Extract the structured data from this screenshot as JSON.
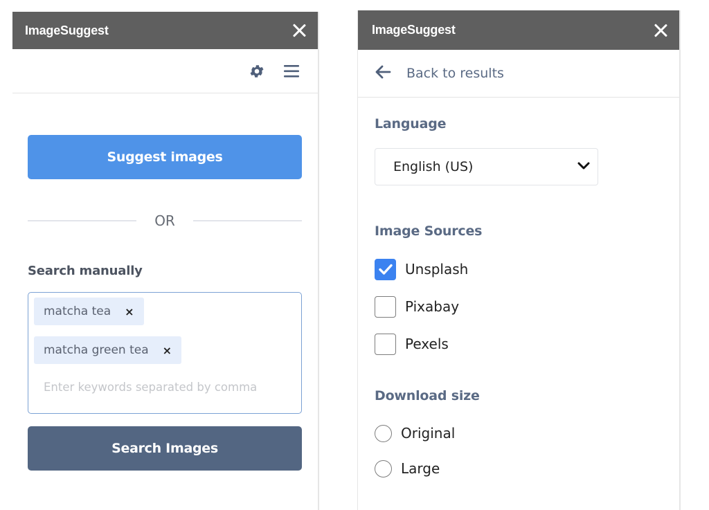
{
  "colors": {
    "titlebar_bg": "#5f5f5f",
    "suggest_button_bg": "#4f93e8",
    "search_button_bg": "#536682",
    "checkbox_checked": "#3b82f0",
    "label_slate": "#5a6a84"
  },
  "left_panel": {
    "title": "ImageSuggest",
    "close_icon": "close-icon",
    "toolbar": {
      "settings_icon": "gear-icon",
      "menu_icon": "hamburger-menu-icon"
    },
    "suggest_button_label": "Suggest images",
    "divider_text": "OR",
    "search_manually_label": "Search manually",
    "keywords": [
      {
        "label": "matcha tea",
        "remove_symbol": "×"
      },
      {
        "label": "matcha green tea",
        "remove_symbol": "×"
      }
    ],
    "keyword_input": {
      "value": "",
      "placeholder": "Enter keywords separated by comma"
    },
    "search_button_label": "Search Images"
  },
  "right_panel": {
    "title": "ImageSuggest",
    "close_icon": "close-icon",
    "back_icon": "arrow-left-icon",
    "back_label": "Back to results",
    "language": {
      "label": "Language",
      "selected": "English (US)"
    },
    "image_sources": {
      "label": "Image Sources",
      "options": [
        {
          "label": "Unsplash",
          "checked": true
        },
        {
          "label": "Pixabay",
          "checked": false
        },
        {
          "label": "Pexels",
          "checked": false
        }
      ]
    },
    "download_size": {
      "label": "Download size",
      "options": [
        {
          "label": "Original",
          "selected": false
        },
        {
          "label": "Large",
          "selected": false
        }
      ]
    }
  }
}
